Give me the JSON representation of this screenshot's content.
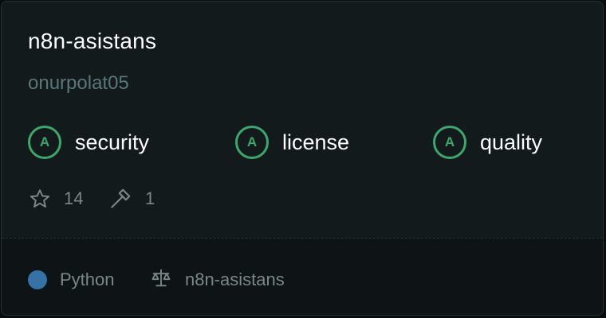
{
  "repo": {
    "name": "n8n-asistans",
    "owner": "onurpolat05"
  },
  "scores": [
    {
      "grade": "A",
      "label": "security"
    },
    {
      "grade": "A",
      "label": "license"
    },
    {
      "grade": "A",
      "label": "quality"
    }
  ],
  "stats": {
    "stars": "14",
    "forks": "1",
    "star_icon": "star-icon",
    "tool_icon": "hammer-icon"
  },
  "footer": {
    "language": "Python",
    "language_color": "#3572a5",
    "license": "n8n-asistans",
    "license_icon": "scale-icon"
  },
  "colors": {
    "grade_accent": "#3aa76d",
    "owner_text": "#58777a",
    "card_bg": "#121a1c"
  }
}
